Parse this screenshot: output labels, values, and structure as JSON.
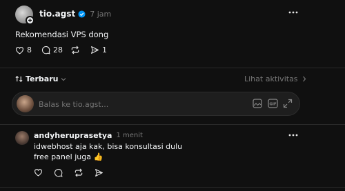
{
  "post": {
    "username": "tio.agst",
    "verified": true,
    "time": "7 jam",
    "text": "Rekomendasi VPS dong",
    "likes": "8",
    "comments": "28",
    "shares": "1"
  },
  "sort": {
    "label": "Terbaru",
    "activity_link": "Lihat aktivitas"
  },
  "reply_box": {
    "placeholder": "Balas ke tio.agst..."
  },
  "reply": {
    "username": "andyheruprasetya",
    "time": "1 menit",
    "line1": "idwebhost aja kak, bisa konsultasi dulu",
    "line2": "free panel juga 👍"
  },
  "colors": {
    "background": "#101010",
    "verified": "#0095f6",
    "input_bg": "#1e1e1e"
  }
}
